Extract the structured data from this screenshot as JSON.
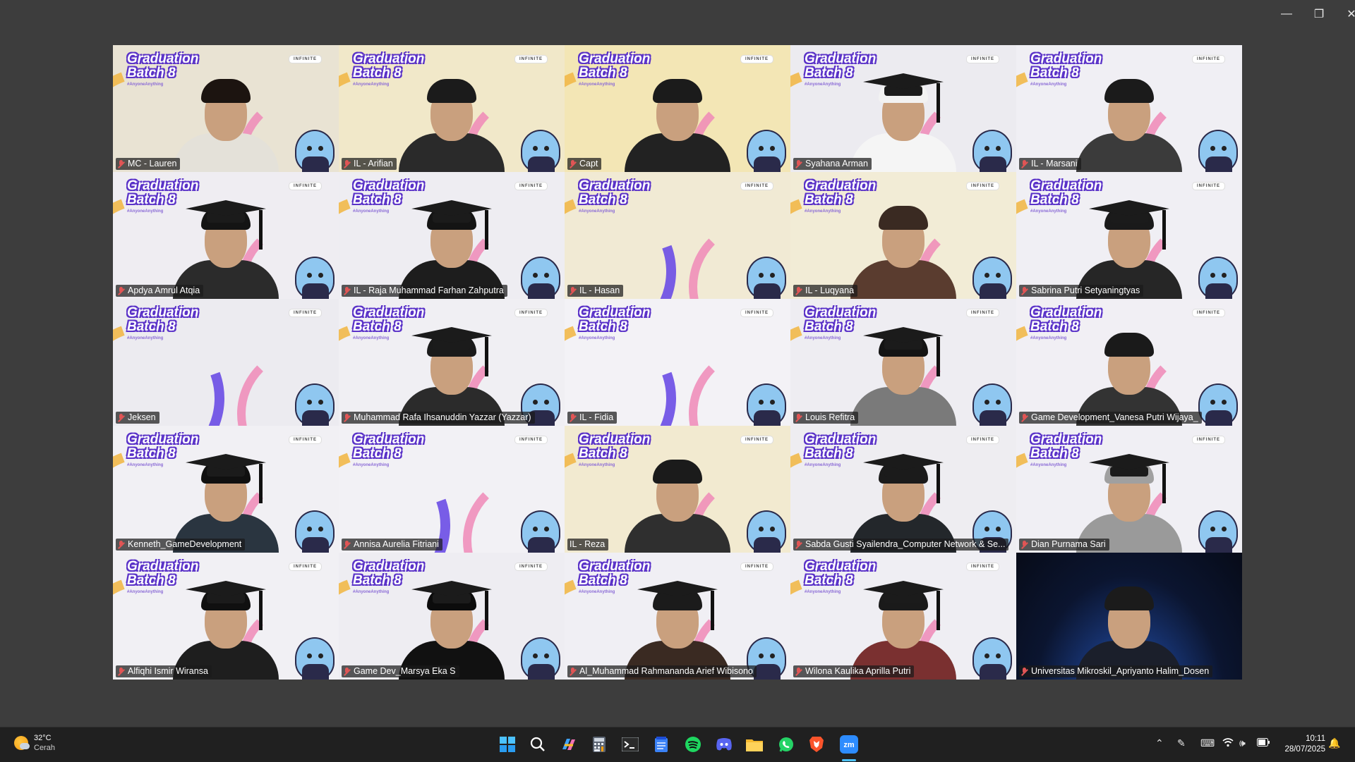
{
  "window": {
    "minimize": "—",
    "restore": "❐",
    "close": "✕"
  },
  "branding": {
    "title_line1": "Graduation",
    "title_line2": "Batch 8",
    "hashtag": "#AnyoneAnything",
    "partner": "INFINITE"
  },
  "participants": [
    {
      "name": "MC - Lauren",
      "bg": "#e9e3d3"
    },
    {
      "name": "IL - Arifian",
      "bg": "#f1e8c9"
    },
    {
      "name": "Capt",
      "bg": "#f3e6b5"
    },
    {
      "name": "Syahana Arman",
      "bg": "#ecebf0"
    },
    {
      "name": "IL - Marsani",
      "bg": "#f0eff4"
    },
    {
      "name": "Apdya Amrul Atqia",
      "bg": "#efedf2"
    },
    {
      "name": "IL - Raja Muhammad Farhan Zahputra",
      "bg": "#eeedf2"
    },
    {
      "name": "IL - Hasan",
      "bg": "#f1ead4"
    },
    {
      "name": "IL - Luqyana",
      "bg": "#f2ecd6"
    },
    {
      "name": "Sabrina Putri Setyaningtyas",
      "bg": "#f0eff4"
    },
    {
      "name": "Jeksen",
      "bg": "#ecebf0"
    },
    {
      "name": "Muhammad Rafa Ihsanuddin Yazzar (Yazzar)",
      "bg": "#f0eff3"
    },
    {
      "name": "IL - Fidia",
      "bg": "#f3f2f6"
    },
    {
      "name": "Louis Refitra",
      "bg": "#eeedf2"
    },
    {
      "name": "Game Development_Vanesa Putri Wijaya_",
      "bg": "#f1eff4"
    },
    {
      "name": "Kenneth_GameDevelopment",
      "bg": "#f1f0f4"
    },
    {
      "name": "Annisa Aurelia Fitriani",
      "bg": "#f2f1f5"
    },
    {
      "name": "IL - Reza",
      "bg": "#f2ead0"
    },
    {
      "name": "Sabda Gusti Syailendra_Computer Network & Se...",
      "bg": "#eeedf1"
    },
    {
      "name": "Dian Purnama Sari",
      "bg": "#f0eff4"
    },
    {
      "name": "Alfiqhi Ismir Wiransa",
      "bg": "#f1f0f4"
    },
    {
      "name": "Game Dev_Marsya Eka S",
      "bg": "#eeedf2"
    },
    {
      "name": "Al_Muhammad Rahmananda Arief Wibisono",
      "bg": "#f0eff4"
    },
    {
      "name": "Wilona Kaulika Aprilla Putri",
      "bg": "#efeef3"
    },
    {
      "name": "Universitas Mikroskil_Apriyanto Halim_Dosen",
      "bg": "space"
    }
  ],
  "taskbar": {
    "weather_temp": "32°C",
    "weather_desc": "Cerah",
    "time": "10:11",
    "date": "28/07/2025",
    "apps": [
      "start-icon",
      "search-icon",
      "copilot-icon",
      "calculator-icon",
      "terminal-icon",
      "notepad-icon",
      "spotify-icon",
      "discord-icon",
      "file-explorer-icon",
      "whatsapp-icon",
      "brave-icon",
      "zoom-icon"
    ]
  },
  "colors": {
    "speaking_border": "#23d09a",
    "accent_purple": "#5a32c8",
    "taskbar": "#202020"
  }
}
